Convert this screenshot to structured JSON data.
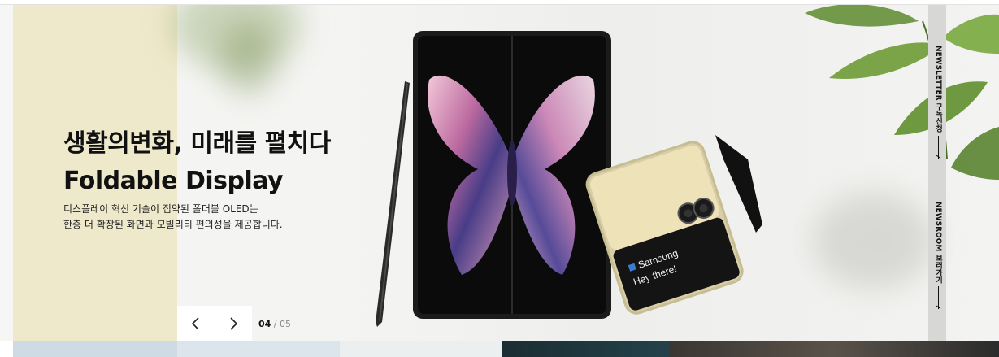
{
  "hero": {
    "headline_line1": "생활의변화, 미래를 펼치다",
    "headline_line2": "Foldable Display",
    "desc_line1": "디스플레이 혁신 기술이 집약된 폴더블 OLED는",
    "desc_line2": "한층 더 확장된 화면과 모빌리티 편의성을 제공합니다.",
    "slide_current": "04",
    "slide_separator": " / ",
    "slide_total": "05",
    "flip_screen_line1": "Samsung",
    "flip_screen_line2": "Hey there!"
  },
  "side_rail": {
    "newsletter_label": "NEWSLETTER 구독신청",
    "newsroom_label": "NEWSROOM 보러가기"
  },
  "icons": {
    "prev": "chevron-left-icon",
    "next": "chevron-right-icon"
  },
  "colors": {
    "beige_block": "#efe9cc",
    "rail": "#d7d7d5",
    "text": "#111111"
  }
}
